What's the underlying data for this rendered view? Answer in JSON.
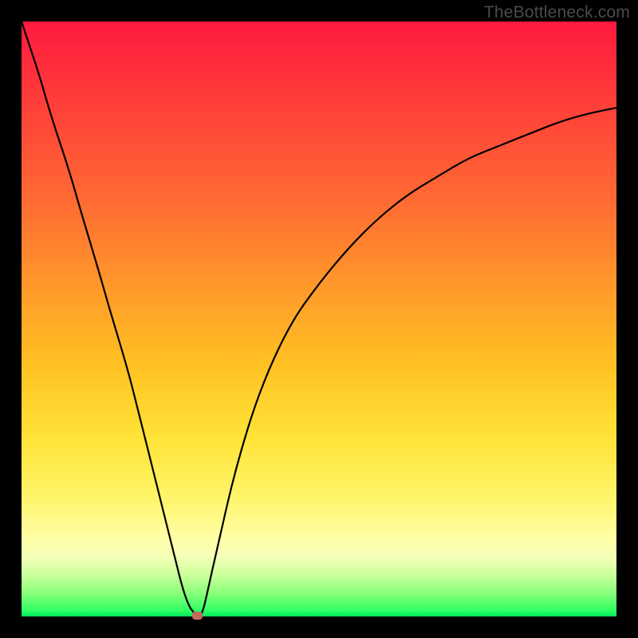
{
  "watermark": "TheBottleneck.com",
  "colors": {
    "frame": "#000000",
    "watermark": "#4a4a4a",
    "curve": "#000000",
    "marker": "#c7695f",
    "gradient_stops": [
      {
        "pct": 0,
        "hex": "#ff1a3f"
      },
      {
        "pct": 12,
        "hex": "#ff3a3a"
      },
      {
        "pct": 30,
        "hex": "#ff6a33"
      },
      {
        "pct": 45,
        "hex": "#ff9a2a"
      },
      {
        "pct": 58,
        "hex": "#ffc222"
      },
      {
        "pct": 70,
        "hex": "#ffe338"
      },
      {
        "pct": 80,
        "hex": "#fff56a"
      },
      {
        "pct": 87,
        "hex": "#ffffa8"
      },
      {
        "pct": 90,
        "hex": "#f5ffb8"
      },
      {
        "pct": 93,
        "hex": "#caff9b"
      },
      {
        "pct": 96,
        "hex": "#8bff7a"
      },
      {
        "pct": 99,
        "hex": "#2fff64"
      },
      {
        "pct": 100,
        "hex": "#00e45a"
      }
    ]
  },
  "chart_data": {
    "type": "line",
    "title": "",
    "xlabel": "",
    "ylabel": "",
    "xlim": [
      0,
      100
    ],
    "ylim": [
      0,
      100
    ],
    "x": [
      0,
      3,
      5,
      8,
      10,
      13,
      15,
      18,
      20,
      22,
      24,
      26,
      27,
      28,
      29,
      29.5,
      30,
      30.5,
      31,
      33,
      36,
      40,
      45,
      50,
      55,
      60,
      65,
      70,
      75,
      80,
      85,
      90,
      95,
      100
    ],
    "y": [
      100,
      91,
      84,
      75,
      68,
      58,
      51,
      41,
      33,
      25,
      17,
      9,
      5,
      2,
      0.5,
      0,
      0,
      1,
      3,
      12,
      25,
      38,
      49,
      56,
      62,
      67,
      71,
      74,
      77,
      79,
      81,
      83,
      84.5,
      85.5
    ],
    "marker": {
      "x": 29.5,
      "y": 0,
      "shape": "rounded-rect"
    },
    "notes": "Values are chart-percentages (0-100 on both axes). Curve descends steeply from top-left, reaches a sharp minimum near x≈29.5, then rises along a concave curve toward the right edge at y≈85.5."
  }
}
